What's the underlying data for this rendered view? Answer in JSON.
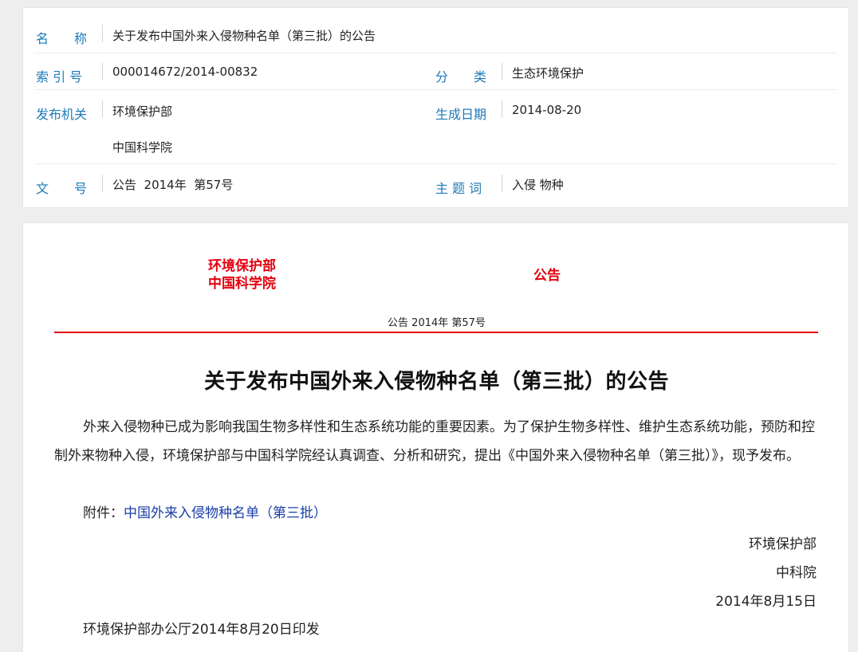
{
  "meta": {
    "name_label": "名　　称",
    "name_value": "关于发布中国外来入侵物种名单（第三批）的公告",
    "index_label": "索 引 号",
    "index_value": "000014672/2014-00832",
    "category_label": "分　　类",
    "category_value": "生态环境保护",
    "issuer_label": "发布机关",
    "issuer_value_1": "环境保护部",
    "issuer_value_2": "中国科学院",
    "date_label": "生成日期",
    "date_value": "2014-08-20",
    "docno_label": "文　　号",
    "docno_value": "公告  2014年  第57号",
    "keywords_label": "主 题 词",
    "keywords_value": "入侵 物种"
  },
  "document": {
    "issuer_1": "环境保护部",
    "issuer_2": "中国科学院",
    "notice_word": "公告",
    "doc_number": "公告 2014年 第57号",
    "title": "关于发布中国外来入侵物种名单（第三批）的公告",
    "paragraph": "外来入侵物种已成为影响我国生物多样性和生态系统功能的重要因素。为了保护生物多样性、维护生态系统功能，预防和控制外来物种入侵，环境保护部与中国科学院经认真调查、分析和研究，提出《中国外来入侵物种名单（第三批）》，现予发布。",
    "attachment_label": "附件：",
    "attachment_link": "中国外来入侵物种名单（第三批）",
    "sign_1": "环境保护部",
    "sign_2": "中科院",
    "sign_date": "2014年8月15日",
    "print_note": "环境保护部办公厅2014年8月20日印发"
  },
  "colors": {
    "label_blue": "#1e7ab8",
    "official_red": "#e3000f",
    "link_blue": "#1a3ea8"
  }
}
